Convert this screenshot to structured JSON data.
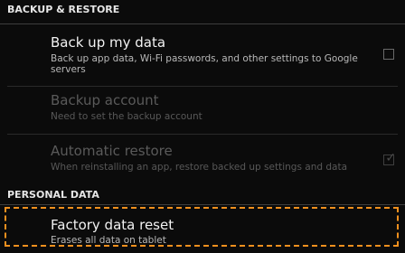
{
  "sections": {
    "backup_restore": "BACKUP & RESTORE",
    "personal_data": "PERSONAL DATA"
  },
  "backup_my_data": {
    "title": "Back up my data",
    "summary": "Back up app data, Wi-Fi passwords, and other settings to Google servers",
    "checked": false
  },
  "backup_account": {
    "title": "Backup account",
    "summary": "Need to set the backup account"
  },
  "automatic_restore": {
    "title": "Automatic restore",
    "summary": "When reinstalling an app, restore backed up settings and data",
    "checked": true
  },
  "factory_reset": {
    "title": "Factory data reset",
    "summary": "Erases all data on tablet"
  },
  "colors": {
    "highlight": "#f0901e",
    "background": "#0b0b0b"
  }
}
